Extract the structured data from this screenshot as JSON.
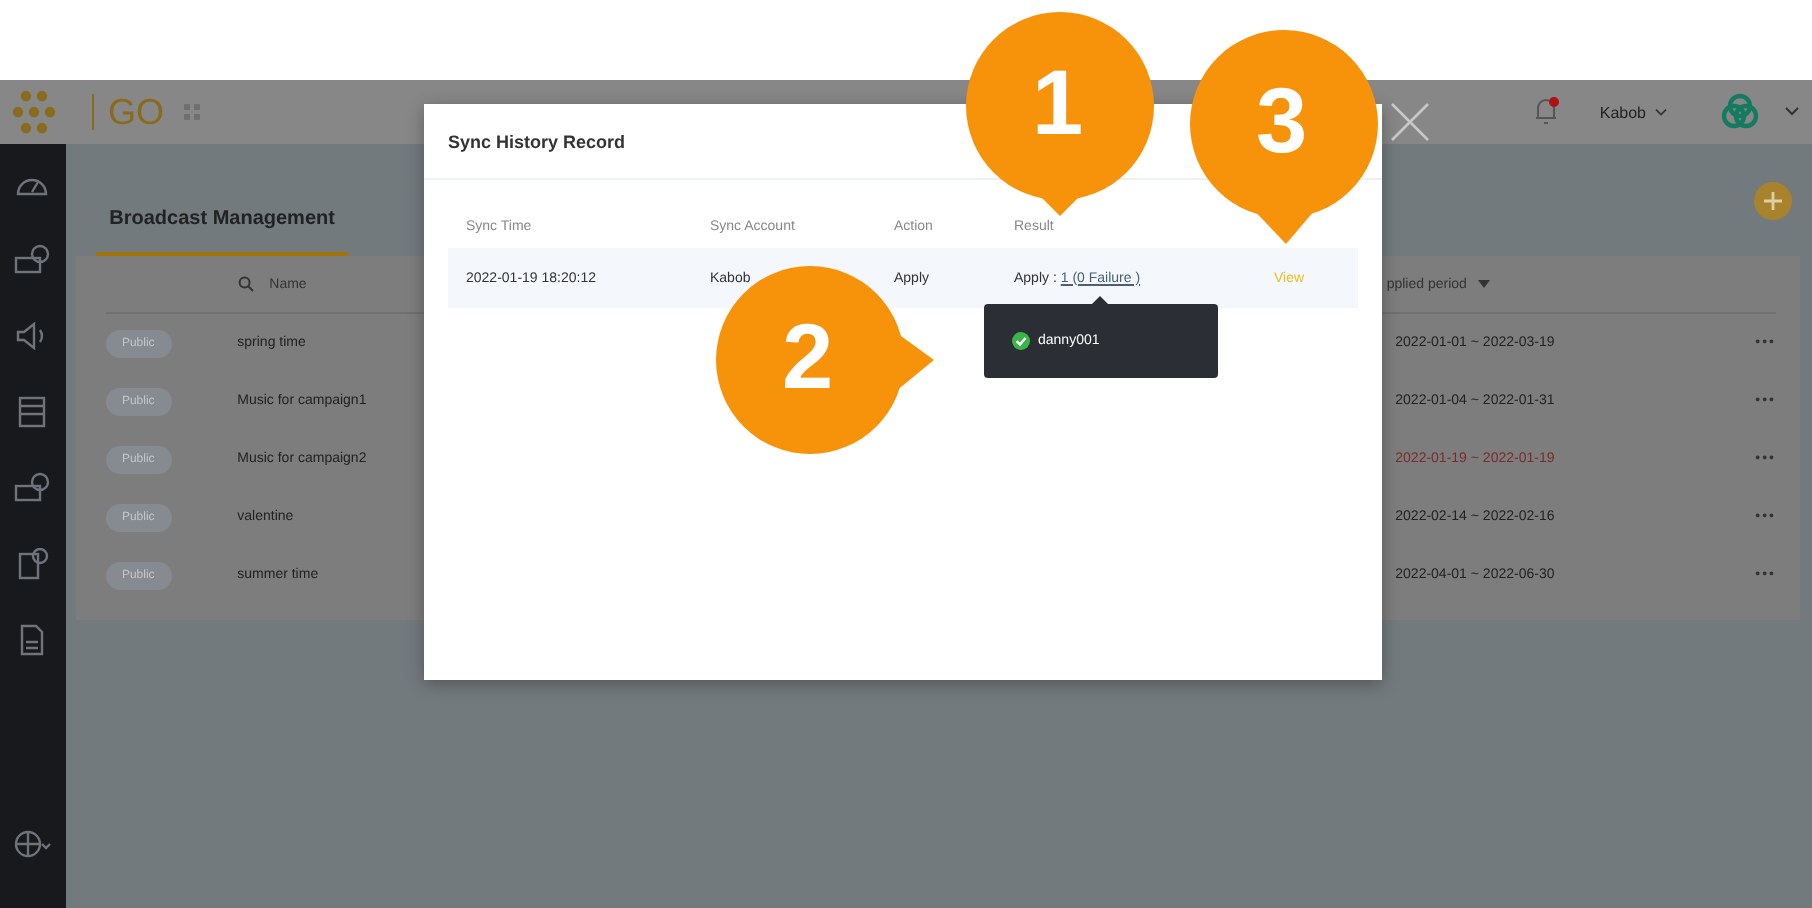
{
  "header": {
    "logo_text": "GO",
    "user": "Kabob",
    "notification_dot": true
  },
  "tabs": [
    {
      "label": "Broadcast Management",
      "selected": true
    }
  ],
  "table": {
    "columns": [
      "Name",
      "pplied period"
    ],
    "rows": [
      {
        "visibility": "Public",
        "name": "spring time",
        "period": "2022-01-01 ~ 2022-03-19",
        "expired": false,
        "more": "•••"
      },
      {
        "visibility": "Public",
        "name": "Music for campaign1",
        "period": "2022-01-04 ~ 2022-01-31",
        "expired": false,
        "more": "•••"
      },
      {
        "visibility": "Public",
        "name": "Music for campaign2",
        "period": "2022-01-19 ~ 2022-01-19",
        "expired": true,
        "more": "•••"
      },
      {
        "visibility": "Public",
        "name": "valentine",
        "period": "2022-02-14 ~ 2022-02-16",
        "expired": false,
        "more": "•••"
      },
      {
        "visibility": "Public",
        "name": "summer time",
        "period": "2022-04-01 ~ 2022-06-30",
        "expired": false,
        "more": "•••"
      }
    ]
  },
  "modal": {
    "title": "Sync History Record",
    "columns": [
      "Sync Time",
      "Sync Account",
      "Action",
      "Result"
    ],
    "rows": [
      {
        "time": "2022-01-19 18:20:12",
        "account": "Kabob",
        "action": "Apply",
        "result_prefix": "Apply :",
        "result_link": "1 (0 Failure )",
        "view": "View"
      }
    ]
  },
  "tooltip": {
    "items": [
      {
        "name": "danny001",
        "success": true
      }
    ]
  },
  "callouts": [
    "1",
    "2",
    "3"
  ]
}
